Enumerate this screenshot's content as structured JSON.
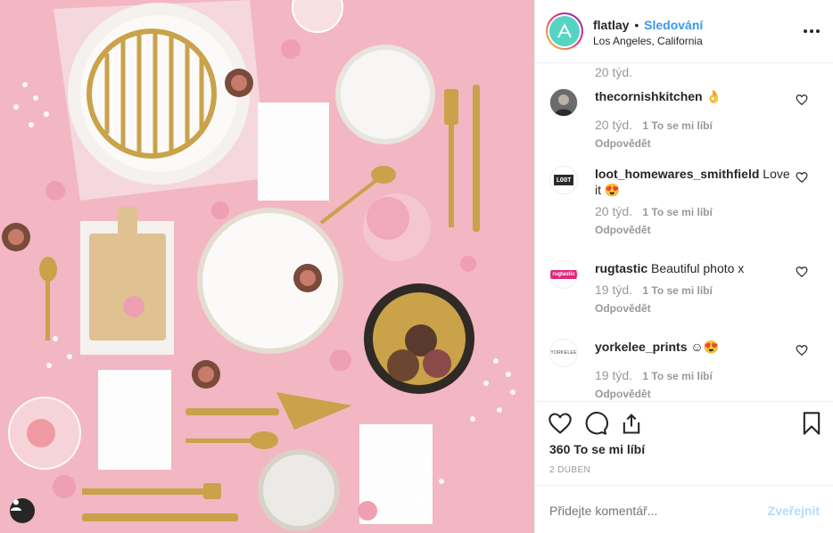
{
  "post": {
    "username": "flatlay",
    "separator": "•",
    "follow_label": "Sledování",
    "location": "Los Angeles, California"
  },
  "comments_top_time": "20 týd.",
  "comments": [
    {
      "username": "thecornishkitchen",
      "text": "👌",
      "time": "20 týd.",
      "likes": "1 To se mi líbí",
      "reply": "Odpovědět",
      "avatar": "thecornishkitchen-avatar"
    },
    {
      "username": "loot_homewares_smithfield",
      "text": "Love it 😍",
      "time": "20 týd.",
      "likes": "1 To se mi líbí",
      "reply": "Odpovědět",
      "avatar": "loot-avatar",
      "avatar_text": "LOOT"
    },
    {
      "username": "rugtastic",
      "text": "Beautiful photo x",
      "time": "19 týd.",
      "likes": "1 To se mi líbí",
      "reply": "Odpovědět",
      "avatar": "rugtastic-avatar",
      "avatar_text": "rugtastic"
    },
    {
      "username": "yorkelee_prints",
      "text": "☺😍",
      "time": "19 týd.",
      "likes": "1 To se mi líbí",
      "reply": "Odpovědět",
      "avatar": "yorkelee-avatar",
      "avatar_text": "YORKELEE"
    }
  ],
  "actions": {
    "likes_count": "360 To se mi líbí",
    "date": "2 DUBEN"
  },
  "add_comment": {
    "placeholder": "Přidejte komentář...",
    "publish_label": "Zveřejnit"
  },
  "colors": {
    "photo_bg": "#f2b7c3",
    "link_blue": "#3897f0",
    "publish_disabled": "#b3dbff",
    "brand_teal": "#56d4c2"
  },
  "icons": [
    "user-tag-icon",
    "more-options-icon",
    "heart-icon",
    "comment-icon",
    "share-icon",
    "bookmark-icon"
  ]
}
